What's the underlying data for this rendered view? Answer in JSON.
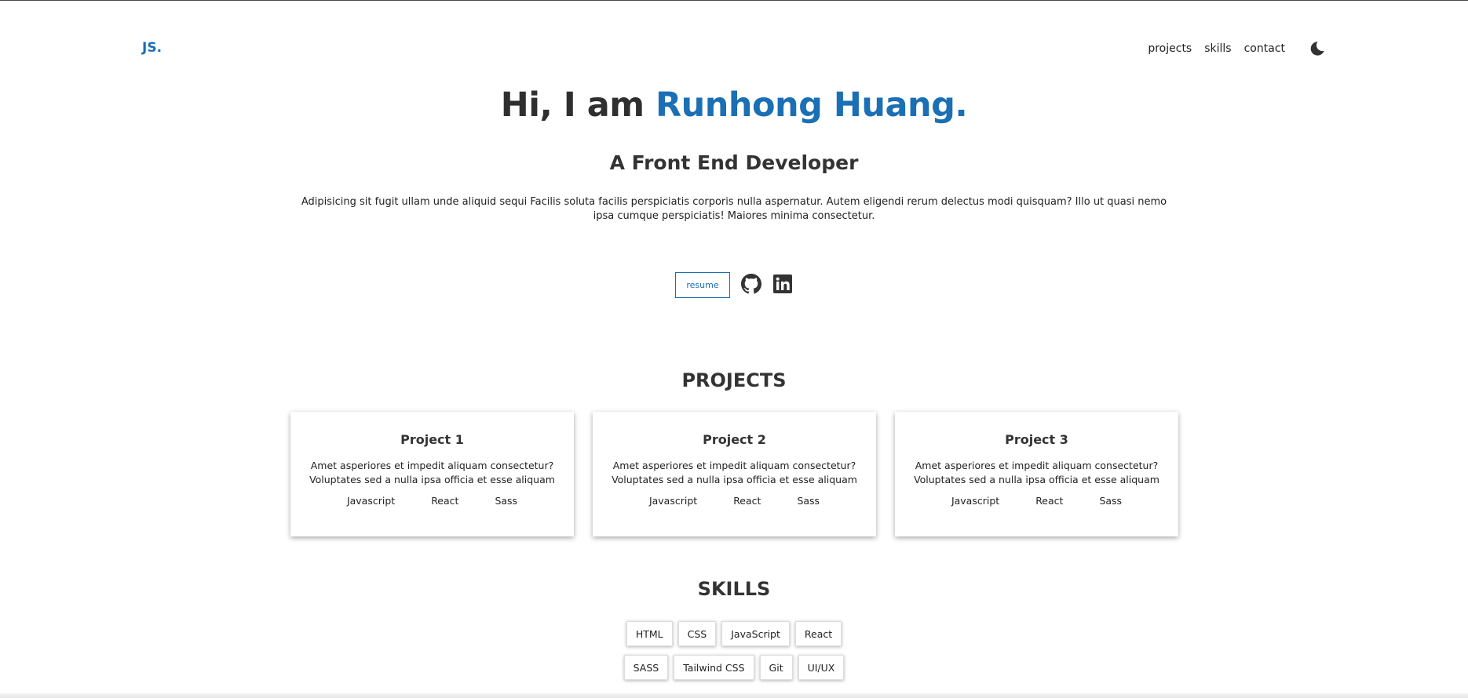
{
  "header": {
    "logo": "JS.",
    "nav": [
      "projects",
      "skills",
      "contact"
    ],
    "theme_icon": "moon-icon"
  },
  "hero": {
    "greeting": "Hi, I am ",
    "name": "Runhong Huang.",
    "subtitle": "A Front End Developer",
    "description": "Adipisicing sit fugit ullam unde aliquid sequi Facilis soluta facilis perspiciatis corporis nulla aspernatur. Autem eligendi rerum delectus modi quisquam? Illo ut quasi nemo ipsa cumque perspiciatis! Maiores minima consectetur.",
    "resume_label": "resume",
    "social_icons": [
      "github-icon",
      "linkedin-icon"
    ]
  },
  "projects": {
    "title": "PROJECTS",
    "items": [
      {
        "title": "Project 1",
        "description": "Amet asperiores et impedit aliquam consectetur? Voluptates sed a nulla ipsa officia et esse aliquam",
        "tags": [
          "Javascript",
          "React",
          "Sass"
        ]
      },
      {
        "title": "Project 2",
        "description": "Amet asperiores et impedit aliquam consectetur? Voluptates sed a nulla ipsa officia et esse aliquam",
        "tags": [
          "Javascript",
          "React",
          "Sass"
        ]
      },
      {
        "title": "Project 3",
        "description": "Amet asperiores et impedit aliquam consectetur? Voluptates sed a nulla ipsa officia et esse aliquam",
        "tags": [
          "Javascript",
          "React",
          "Sass"
        ]
      }
    ]
  },
  "skills": {
    "title": "SKILLS",
    "row1": [
      "HTML",
      "CSS",
      "JavaScript",
      "React"
    ],
    "row2": [
      "SASS",
      "Tailwind CSS",
      "Git",
      "UI/UX"
    ]
  },
  "colors": {
    "accent": "#1a6fb5",
    "text": "#2f2f2f"
  }
}
